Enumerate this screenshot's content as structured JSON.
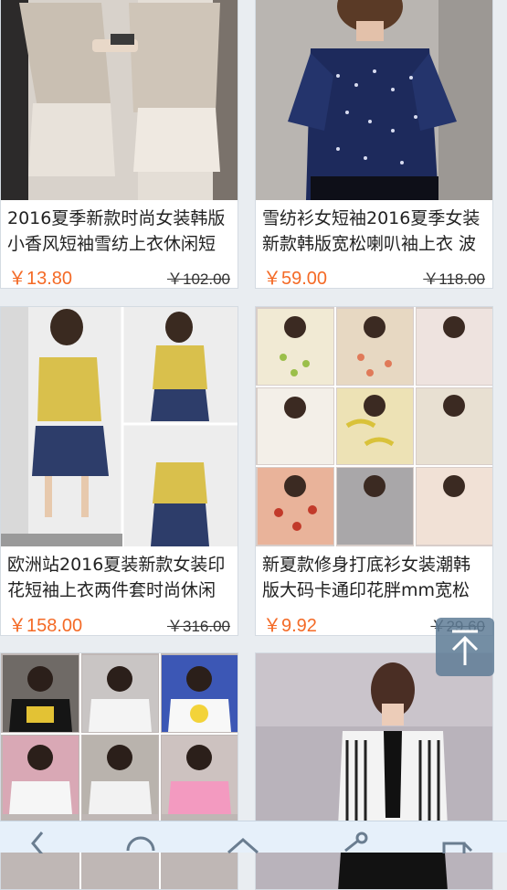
{
  "products": [
    {
      "title": "2016夏季新款时尚女装韩版小香风短袖雪纺上衣休闲短",
      "price": "￥13.80",
      "original_price": "￥102.00",
      "image": "beige-two-piece-outfit"
    },
    {
      "title": "雪纺衫女短袖2016夏季女装新款韩版宽松喇叭袖上衣 波",
      "price": "￥59.00",
      "original_price": "￥118.00",
      "image": "navy-polka-dot-blouse"
    },
    {
      "title": "欧洲站2016夏装新款女装印花短袖上衣两件套时尚休闲",
      "price": "￥158.00",
      "original_price": "￥316.00",
      "image": "yellow-top-denim-shorts"
    },
    {
      "title": "新夏款修身打底衫女装潮韩版大码卡通印花胖mm宽松",
      "price": "￥9.92",
      "original_price": "￥29.60",
      "image": "printed-tshirt-collage"
    },
    {
      "title": "",
      "price": "",
      "original_price": "",
      "image": "cartoon-tshirt-grid"
    },
    {
      "title": "",
      "price": "",
      "original_price": "",
      "image": "striped-ruffle-blouse"
    }
  ],
  "colors": {
    "price": "#f46a26",
    "background": "#e9edf1",
    "navbar": "#e6f0fa",
    "scroll_button": "#5f7d96"
  },
  "icons": {
    "scroll_top": "arrow-up-to-line-icon",
    "nav": [
      "back-icon",
      "refresh-icon",
      "home-icon",
      "share-icon",
      "tabs-icon"
    ]
  }
}
